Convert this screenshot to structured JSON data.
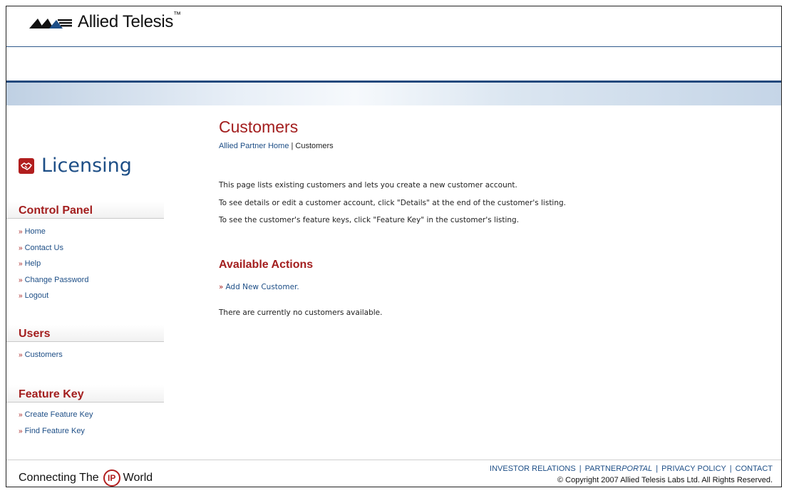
{
  "brand": {
    "name": "Allied Telesis",
    "tm": "™"
  },
  "sidebar": {
    "title": "Licensing",
    "sections": [
      {
        "heading": "Control Panel",
        "items": [
          "Home",
          "Contact Us",
          "Help",
          "Change Password",
          "Logout"
        ]
      },
      {
        "heading": "Users",
        "items": [
          "Customers"
        ]
      },
      {
        "heading": "Feature Key",
        "items": [
          "Create Feature Key",
          "Find Feature Key"
        ]
      }
    ]
  },
  "main": {
    "title": "Customers",
    "breadcrumb": {
      "home": "Allied Partner Home",
      "separator": "|",
      "current": "Customers"
    },
    "description": [
      "This page lists existing customers and lets you create a new customer account.",
      "To see details or edit a customer account, click \"Details\" at the end of the customer's listing.",
      "To see the customer's feature keys, click \"Feature Key\" in the customer's listing."
    ],
    "actions_heading": "Available Actions",
    "add_customer_link": "Add New Customer.",
    "empty_message": "There are currently no customers available."
  },
  "footer": {
    "tagline_before": "Connecting The",
    "tagline_ip": "IP",
    "tagline_after": "World",
    "links": {
      "investor": "INVESTOR RELATIONS",
      "partner_a": "PARTNER",
      "partner_b": "PORTAL",
      "privacy": "PRIVACY POLICY",
      "contact": "CONTACT",
      "sep": "|"
    },
    "copyright": "© Copyright 2007   Allied Telesis Labs Ltd.   All Rights Reserved."
  },
  "colors": {
    "accent_red": "#a31e1e",
    "link_blue": "#1d4e86",
    "banner_navy": "#23497d"
  },
  "icons": {
    "logo": "allied-telesis-logo-icon",
    "licensing": "handshake-icon",
    "bullet": "double-chevron-right-icon"
  }
}
